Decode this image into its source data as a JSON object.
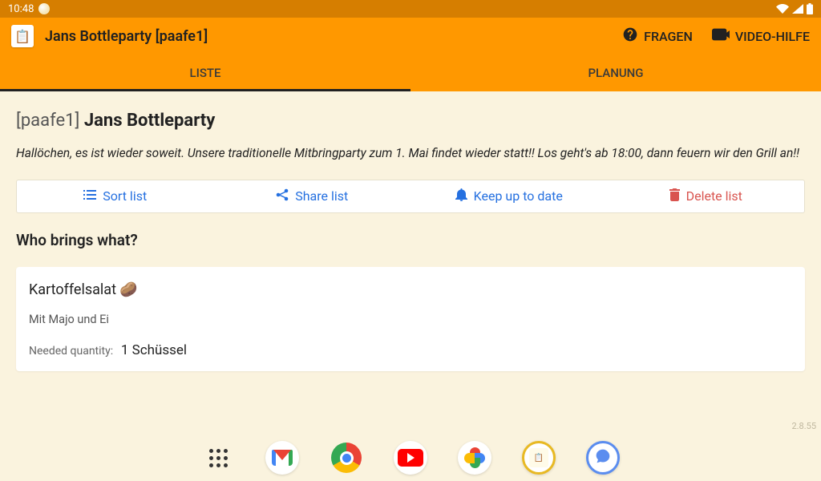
{
  "statusbar": {
    "time": "10:48"
  },
  "appbar": {
    "title": "Jans Bottleparty [paafe1]",
    "fragen_label": "FRAGEN",
    "video_label": "VIDEO-HILFE"
  },
  "tabs": {
    "liste": "LISTE",
    "planung": "PLANUNG",
    "active": "liste"
  },
  "list": {
    "code": "[paafe1]",
    "name": "Jans Bottleparty",
    "description": "Hallöchen, es ist wieder soweit. Unsere traditionelle Mitbringparty zum 1. Mai findet wieder statt!! Los geht's ab 18:00, dann feuern wir den Grill an!!"
  },
  "actions": {
    "sort": "Sort list",
    "share": "Share list",
    "keep": "Keep up to date",
    "delete": "Delete list"
  },
  "section_heading": "Who brings what?",
  "items": [
    {
      "name": "Kartoffelsalat 🥔",
      "description": "Mit Majo und Ei",
      "qty_label": "Needed quantity:",
      "qty_value": "1 Schüssel"
    }
  ],
  "version": "2.8.55",
  "colors": {
    "primary": "#ff9800",
    "status": "#d67e00",
    "link": "#2570e0",
    "danger": "#d9544f",
    "surface": "#faf3de"
  }
}
